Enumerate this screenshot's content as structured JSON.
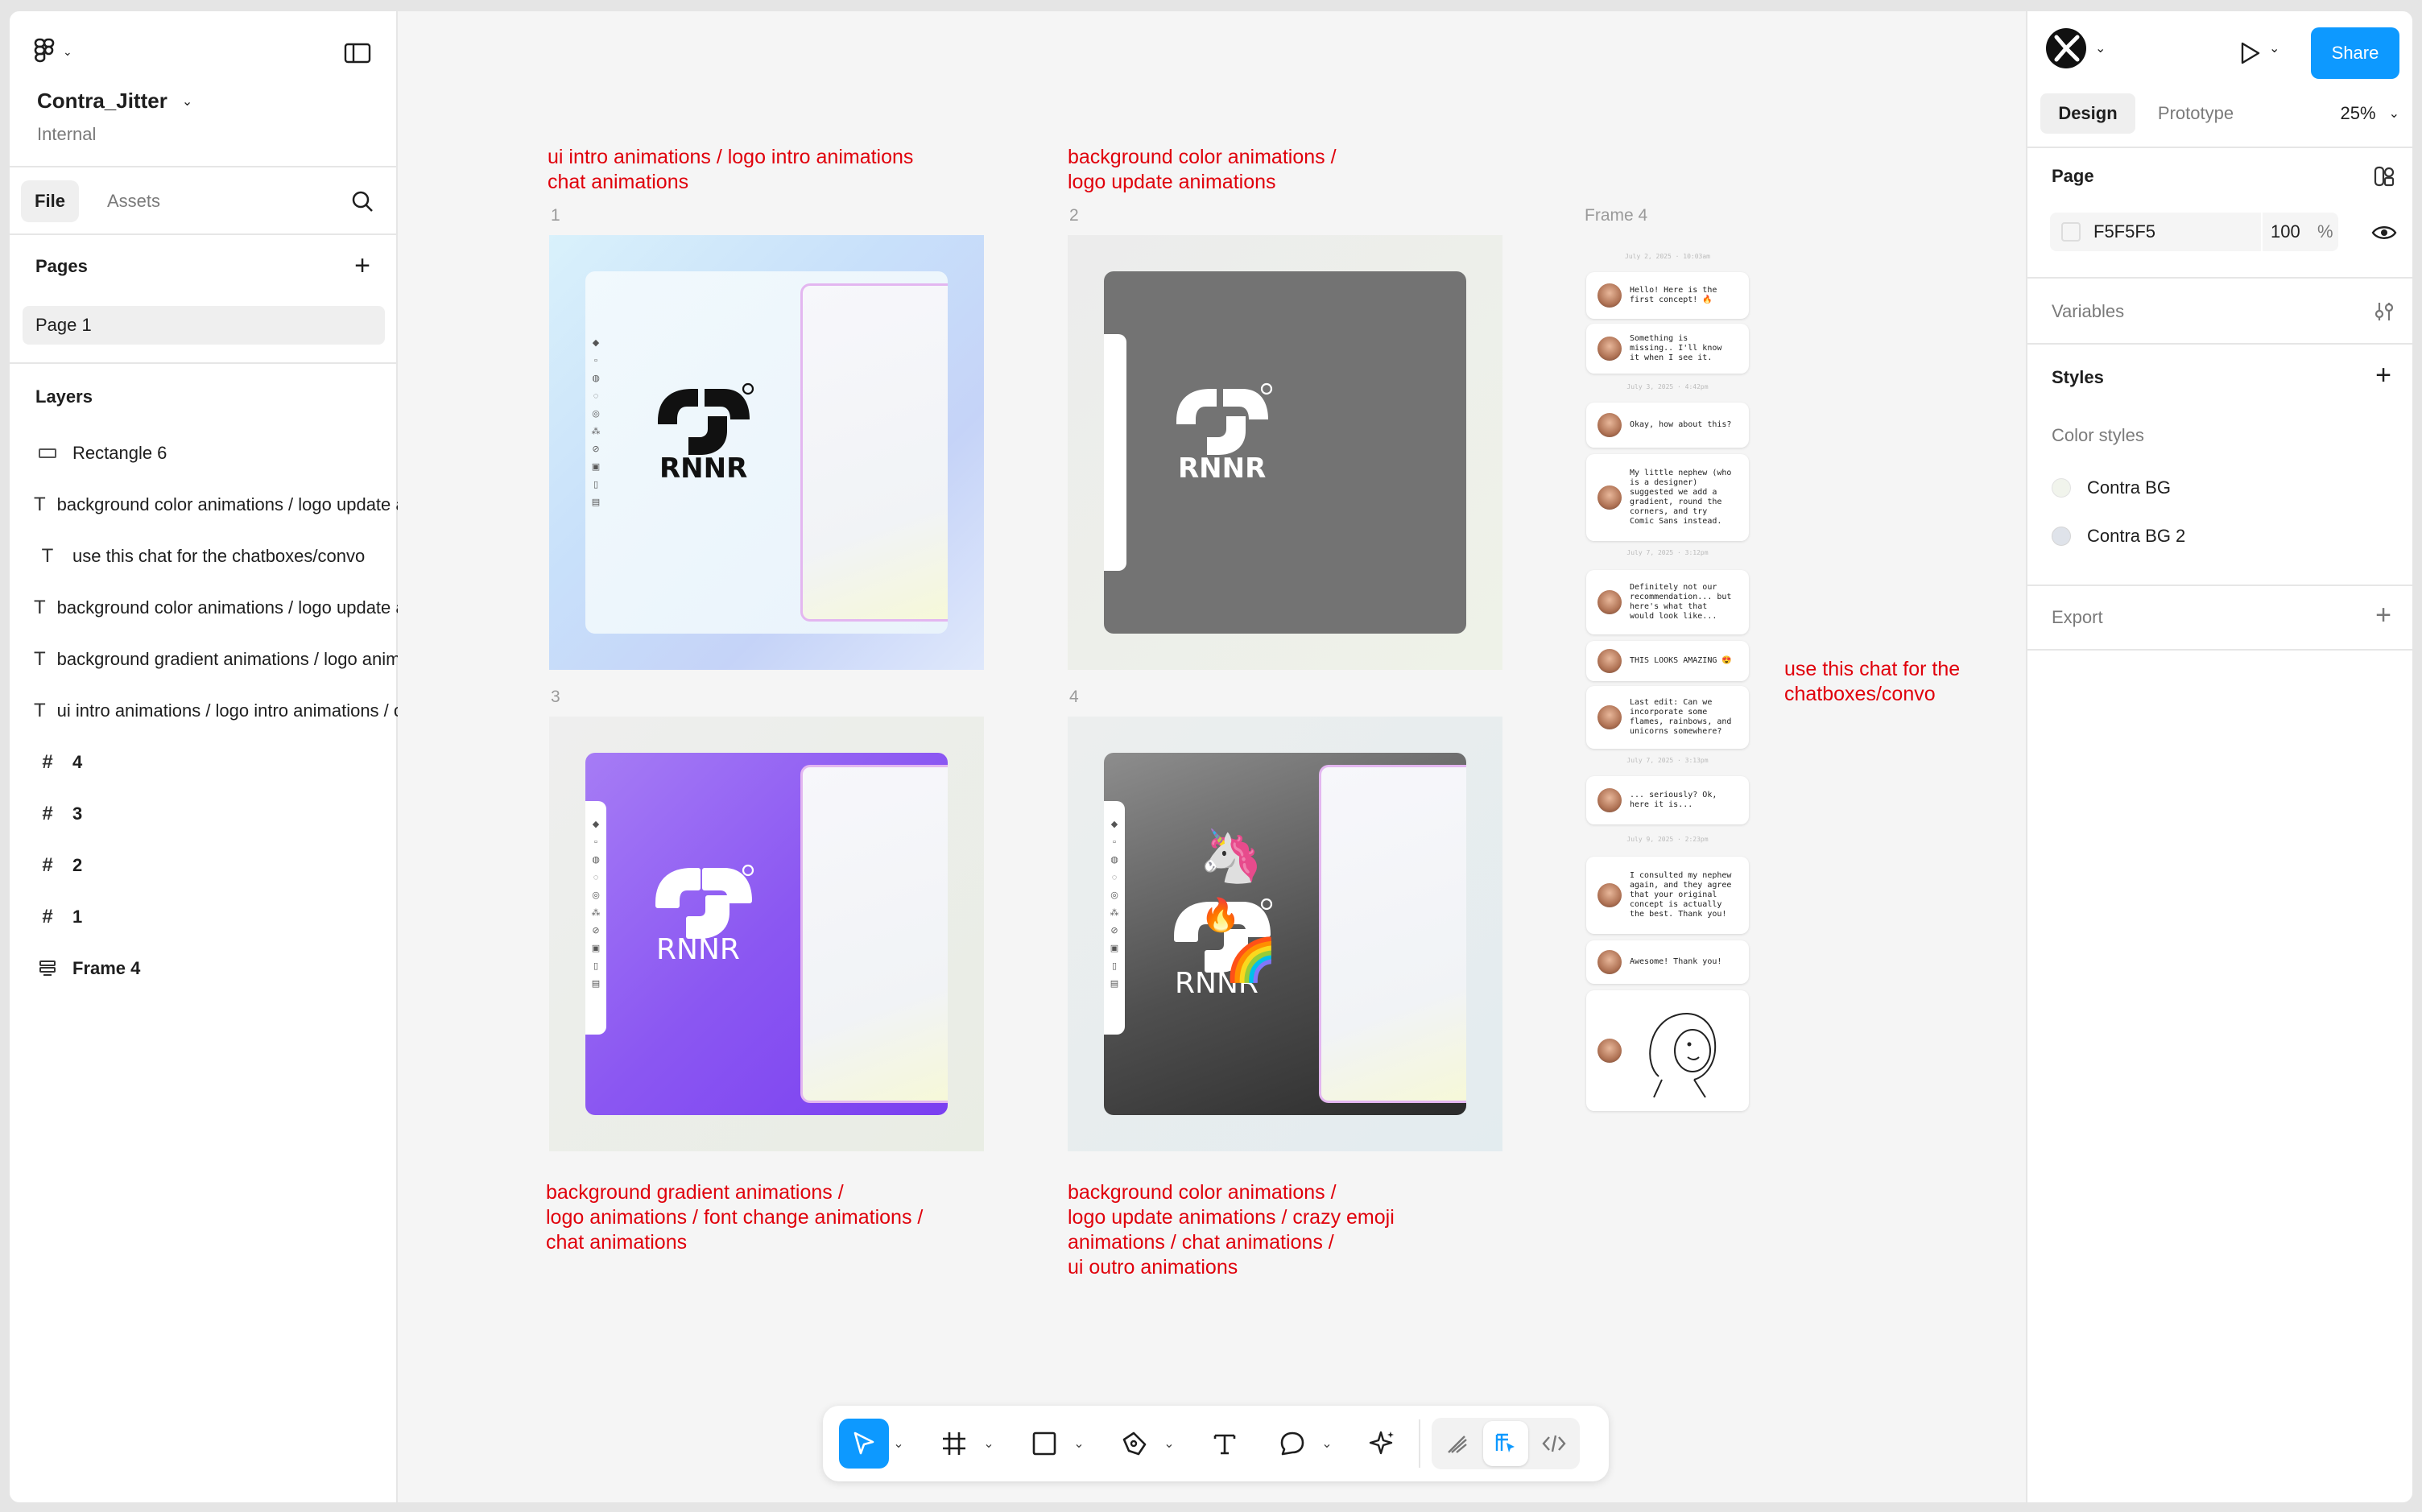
{
  "file": {
    "name": "Contra_Jitter",
    "team": "Internal"
  },
  "left_panel": {
    "tabs": [
      "File",
      "Assets"
    ],
    "pages_heading": "Pages",
    "pages": [
      "Page 1"
    ],
    "layers_heading": "Layers",
    "layers": [
      {
        "icon": "rectangle-icon",
        "label": "Rectangle 6"
      },
      {
        "icon": "text-icon",
        "label": "background color animations / logo update animations"
      },
      {
        "icon": "text-icon",
        "label": "use this chat for the chatboxes/convo"
      },
      {
        "icon": "text-icon",
        "label": "background color animations / logo update animations / crazy emoji animations / chat animations / ui outro animations"
      },
      {
        "icon": "text-icon",
        "label": "background gradient animations / logo animations / font change animations / chat animations"
      },
      {
        "icon": "text-icon",
        "label": "ui intro animations / logo intro animations / chat animations"
      },
      {
        "icon": "frame-icon",
        "label": "4"
      },
      {
        "icon": "frame-icon",
        "label": "3"
      },
      {
        "icon": "frame-icon",
        "label": "2"
      },
      {
        "icon": "frame-icon",
        "label": "1"
      },
      {
        "icon": "auto-layout-frame-icon",
        "label": "Frame 4"
      }
    ]
  },
  "right_panel": {
    "share_label": "Share",
    "tabs": [
      "Design",
      "Prototype"
    ],
    "zoom": "25%",
    "page_section": {
      "heading": "Page",
      "bg_hex": "F5F5F5",
      "opacity": "100",
      "opacity_unit": "%"
    },
    "variables_heading": "Variables",
    "styles_heading": "Styles",
    "color_styles_heading": "Color styles",
    "color_styles": [
      {
        "name": "Contra BG",
        "swatch": "#f1f4ec"
      },
      {
        "name": "Contra BG 2",
        "swatch": "#dfe3ea"
      }
    ],
    "export_heading": "Export"
  },
  "canvas": {
    "notes": {
      "n1_line1": "ui intro animations / logo intro animations",
      "n1_line2": "chat animations",
      "n2_line1": "background color animations /",
      "n2_line2": "logo update animations",
      "n3_line1": "background gradient animations /",
      "n3_line2": "logo animations / font change animations /",
      "n3_line3": "chat animations",
      "n4_line1": "background color animations /",
      "n4_line2": "logo update animations / crazy emoji",
      "n4_line3": "animations / chat animations /",
      "n4_line4": "ui outro animations",
      "chat_note_line1": "use this chat for the",
      "chat_note_line2": "chatboxes/convo"
    },
    "frames": [
      {
        "label": "1",
        "wordmark": "RNNR"
      },
      {
        "label": "2",
        "wordmark": "RNNR"
      },
      {
        "label": "3",
        "wordmark": "RNNR"
      },
      {
        "label": "4",
        "wordmark": "RNNR"
      }
    ],
    "chat_frame_label": "Frame 4",
    "chat": {
      "date1": "July 2, 2025 · 10:03am",
      "m1": "Hello! Here is the\nfirst concept! 🔥",
      "m2": "Something is\nmissing.. I'll know\nit when I see it.",
      "date2": "July 3, 2025 · 4:42pm",
      "m3": "Okay, how about this?",
      "m4": "My little nephew (who\nis a designer)\nsuggested we add a\ngradient, round the\ncorners, and try\nComic Sans instead.",
      "date3": "July 7, 2025 · 3:12pm",
      "m5": "Definitely not our\nrecommendation... but\nhere's what that\nwould look like...",
      "m6": "THIS LOOKS AMAZING 😍",
      "m7": "Last edit: Can we\nincorporate some\nflames, rainbows, and\nunicorns somewhere?",
      "date4": "July 7, 2025 · 3:13pm",
      "m8": "... seriously? Ok,\nhere it is...",
      "date5": "July 9, 2025 · 2:23pm",
      "m9": "I consulted my nephew\nagain, and they agree\nthat your original\nconcept is actually\nthe best. Thank you!",
      "m10": "Awesome! Thank you!"
    }
  },
  "toolbar": {
    "tools": [
      "move-tool",
      "frame-tool",
      "shape-tool",
      "pen-tool",
      "text-tool",
      "comment-tool",
      "actions-tool",
      "draw-mode",
      "design-mode",
      "dev-mode"
    ]
  },
  "help_label": "?"
}
